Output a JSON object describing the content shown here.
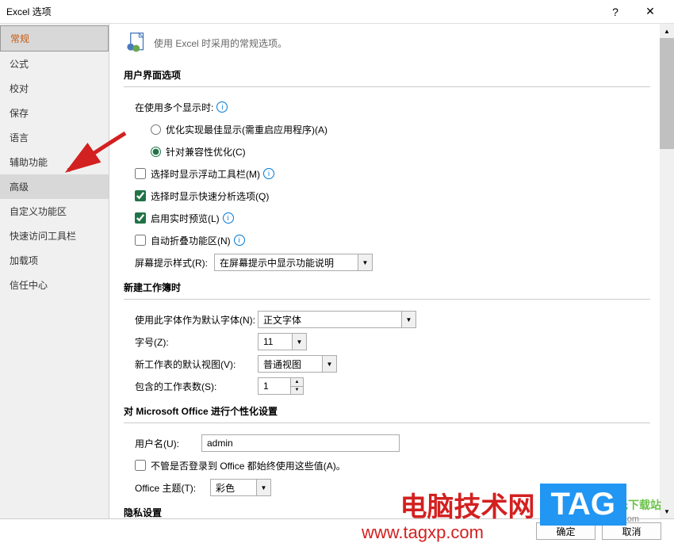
{
  "titlebar": {
    "title": "Excel 选项"
  },
  "sidebar": {
    "items": [
      {
        "label": "常规",
        "state": "selected"
      },
      {
        "label": "公式"
      },
      {
        "label": "校对"
      },
      {
        "label": "保存"
      },
      {
        "label": "语言"
      },
      {
        "label": "辅助功能"
      },
      {
        "label": "高级",
        "state": "highlight"
      },
      {
        "label": "自定义功能区"
      },
      {
        "label": "快速访问工具栏"
      },
      {
        "label": "加载项"
      },
      {
        "label": "信任中心"
      }
    ]
  },
  "header": {
    "text": "使用 Excel 时采用的常规选项。"
  },
  "sections": {
    "ui": {
      "title": "用户界面选项",
      "multi_monitor_label": "在使用多个显示时:",
      "radio_optimize": "优化实现最佳显示(需重启应用程序)(A)",
      "radio_compat": "针对兼容性优化(C)",
      "check_floating": "选择时显示浮动工具栏(M)",
      "check_quick_analysis": "选择时显示快速分析选项(Q)",
      "check_live_preview": "启用实时预览(L)",
      "check_auto_collapse": "自动折叠功能区(N)",
      "screentip_label": "屏幕提示样式(R):",
      "screentip_value": "在屏幕提示中显示功能说明"
    },
    "newwb": {
      "title": "新建工作簿时",
      "font_label": "使用此字体作为默认字体(N):",
      "font_value": "正文字体",
      "size_label": "字号(Z):",
      "size_value": "11",
      "view_label": "新工作表的默认视图(V):",
      "view_value": "普通视图",
      "sheets_label": "包含的工作表数(S):",
      "sheets_value": "1"
    },
    "personalize": {
      "title": "对 Microsoft Office 进行个性化设置",
      "username_label": "用户名(U):",
      "username_value": "admin",
      "check_always_values": "不管是否登录到 Office 都始终使用这些值(A)。",
      "theme_label": "Office 主题(T):",
      "theme_value": "彩色"
    },
    "privacy": {
      "title": "隐私设置"
    }
  },
  "footer": {
    "ok": "确定",
    "cancel": "取消"
  },
  "watermarks": {
    "site1_name": "电脑技术网",
    "site1_url": "www.tagxp.com",
    "tag": "TAG",
    "site2_name": "极光下载站",
    "site2_url": "www.xz7.com"
  }
}
